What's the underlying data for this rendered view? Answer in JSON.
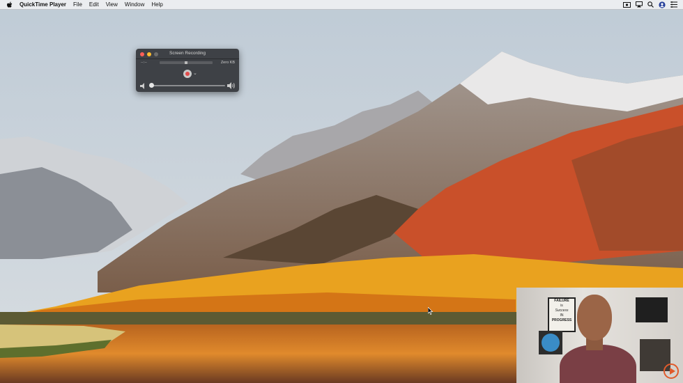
{
  "menubar": {
    "app_name": "QuickTime Player",
    "menus": [
      "File",
      "Edit",
      "View",
      "Window",
      "Help"
    ],
    "status_icons": [
      "screen-record-status-icon",
      "airplay-icon",
      "search-icon",
      "user-avatar-icon",
      "control-center-icon"
    ]
  },
  "qt_panel": {
    "title": "Screen Recording",
    "time": "--:--",
    "file_size": "Zero KB",
    "volume_level": 0.02,
    "colors": {
      "close": "#fe5f57",
      "minimize": "#febc2e",
      "zoom": "#6d6d6d",
      "record": "#e14b4b"
    }
  },
  "webcam": {
    "poster_text": [
      "FAILURE",
      "is",
      "Success",
      "IN",
      "PROGRESS"
    ],
    "play_icon_color": "#e05a2b"
  }
}
